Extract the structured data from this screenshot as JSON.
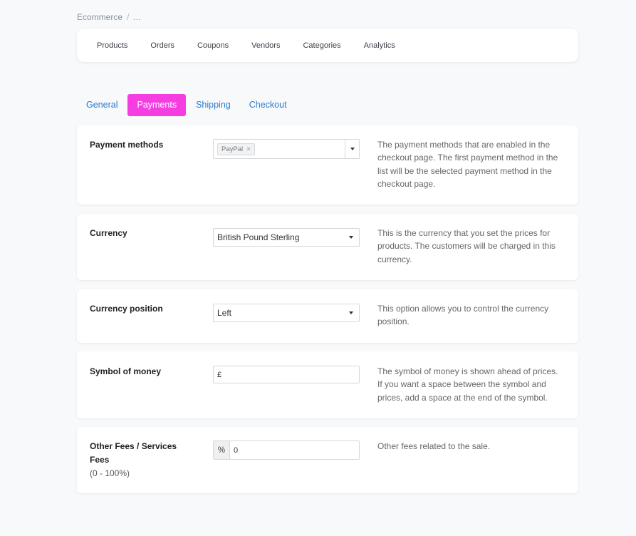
{
  "breadcrumb": {
    "root": "Ecommerce",
    "separator": "/",
    "current": "..."
  },
  "topnav": {
    "items": [
      {
        "label": "Products"
      },
      {
        "label": "Orders"
      },
      {
        "label": "Coupons"
      },
      {
        "label": "Vendors"
      },
      {
        "label": "Categories"
      },
      {
        "label": "Analytics"
      }
    ]
  },
  "tabs": {
    "items": [
      {
        "label": "General"
      },
      {
        "label": "Payments",
        "active": true
      },
      {
        "label": "Shipping"
      },
      {
        "label": "Checkout"
      }
    ],
    "active_color": "#f53ee1",
    "link_color": "#2a7bd1"
  },
  "settings": {
    "payment_methods": {
      "label": "Payment methods",
      "tags": [
        "PayPal"
      ],
      "tag_remove": "×",
      "description": "The payment methods that are enabled in the checkout page. The first payment method in the list will be the selected payment method in the checkout page."
    },
    "currency": {
      "label": "Currency",
      "value": "British Pound Sterling",
      "description": "This is the currency that you set the prices for products. The customers will be charged in this currency."
    },
    "currency_position": {
      "label": "Currency position",
      "value": "Left",
      "description": "This option allows you to control the currency position."
    },
    "symbol_of_money": {
      "label": "Symbol of money",
      "value": "£",
      "description": "The symbol of money is shown ahead of prices. If you want a space between the symbol and prices, add a space at the end of the symbol."
    },
    "other_fees": {
      "label": "Other Fees / Services Fees",
      "sublabel": "(0 - 100%)",
      "addon": "%",
      "value": "0",
      "description": "Other fees related to the sale."
    }
  }
}
